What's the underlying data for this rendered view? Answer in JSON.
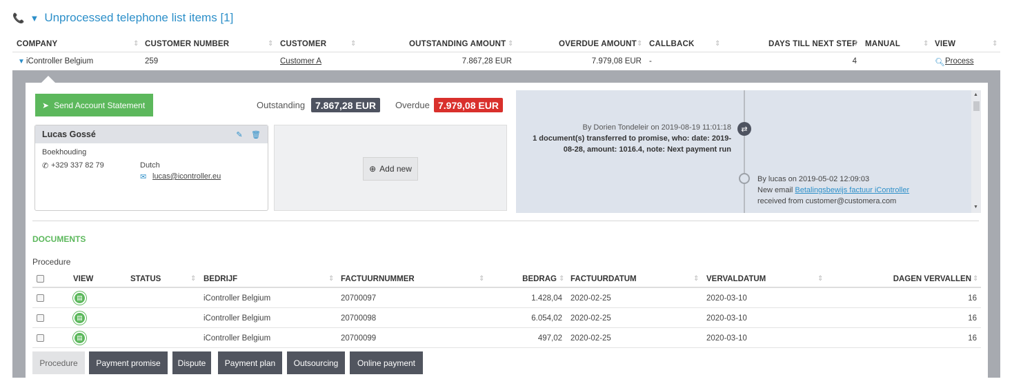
{
  "header": {
    "title": "Unprocessed telephone list items [1]"
  },
  "table": {
    "columns": [
      "COMPANY",
      "CUSTOMER NUMBER",
      "CUSTOMER",
      "OUTSTANDING AMOUNT",
      "OVERDUE AMOUNT",
      "CALLBACK",
      "DAYS TILL NEXT STEP",
      "MANUAL",
      "VIEW"
    ],
    "row": {
      "company": "iController Belgium",
      "customer_number": "259",
      "customer": "Customer A",
      "outstanding": "7.867,28 EUR",
      "overdue": "7.979,08 EUR",
      "callback": "-",
      "days": "4",
      "view": "Process"
    }
  },
  "actions": {
    "send_statement": "Send Account Statement",
    "add_new": "Add new"
  },
  "summary": {
    "outstanding_label": "Outstanding",
    "outstanding_value": "7.867,28 EUR",
    "overdue_label": "Overdue",
    "overdue_value": "7.979,08 EUR",
    "colors": {
      "outstanding": "#4e5360",
      "overdue": "#d9302c",
      "accent": "#5cb85c",
      "link": "#2c8fc9"
    }
  },
  "contact": {
    "name": "Lucas Gossé",
    "department": "Boekhouding",
    "phone": "+329 337 82 79",
    "language": "Dutch",
    "email": "lucas@icontroller.eu"
  },
  "timeline": {
    "entry1": {
      "meta": "By Dorien Tondeleir on 2019-08-19 11:01:18",
      "text": "1 document(s) transferred to promise, who: date: 2019-08-28, amount: 1016.4, note: Next payment run"
    },
    "entry2": {
      "meta": "By lucas on 2019-05-02 12:09:03",
      "prefix": "New email",
      "link": "Betalingsbewijs factuur iController",
      "suffix": "received from customer@customera.com"
    }
  },
  "documents": {
    "title": "DOCUMENTS",
    "procedure_label": "Procedure",
    "columns": [
      "VIEW",
      "STATUS",
      "BEDRIJF",
      "FACTUURNUMMER",
      "BEDRAG",
      "FACTUURDATUM",
      "VERVALDATUM",
      "DAGEN VERVALLEN"
    ],
    "rows": [
      {
        "company": "iController Belgium",
        "invoice": "20700097",
        "amount": "1.428,04",
        "invoice_date": "2020-02-25",
        "due_date": "2020-03-10",
        "days": "16"
      },
      {
        "company": "iController Belgium",
        "invoice": "20700098",
        "amount": "6.054,02",
        "invoice_date": "2020-02-25",
        "due_date": "2020-03-10",
        "days": "16"
      },
      {
        "company": "iController Belgium",
        "invoice": "20700099",
        "amount": "497,02",
        "invoice_date": "2020-02-25",
        "due_date": "2020-03-10",
        "days": "16"
      }
    ]
  },
  "tabs": [
    "Procedure",
    "Payment promise",
    "Dispute",
    "Payment plan",
    "Outsourcing",
    "Online payment"
  ]
}
